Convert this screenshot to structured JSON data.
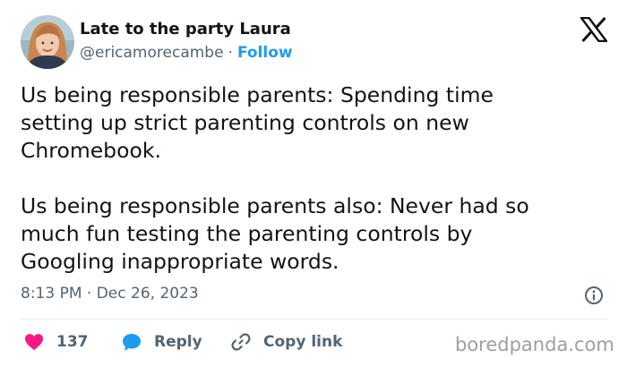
{
  "author": {
    "display_name": "Late to the party Laura",
    "handle": "@ericamorecambe",
    "separator": "·",
    "follow_label": "Follow"
  },
  "tweet": {
    "text": "Us being responsible parents: Spending time\nsetting up strict parenting controls on new\nChromebook.\n\nUs being responsible parents also: Never had so\nmuch fun testing the parenting controls by\nGoogling inappropriate words.",
    "timestamp": "8:13 PM · Dec 26, 2023"
  },
  "actions": {
    "like_count": "137",
    "reply_label": "Reply",
    "copy_link_label": "Copy link"
  },
  "icons": {
    "platform_logo": "x-logo-icon",
    "info": "info-icon",
    "like": "heart-icon",
    "reply": "speech-bubble-icon",
    "copy_link": "link-icon"
  },
  "colors": {
    "accent": "#1d9bf0",
    "like": "#f91880",
    "text": "#0f1419",
    "secondary_text": "#536471",
    "divider": "#e6ecf0"
  },
  "watermark": {
    "text": "boredpanda.com"
  }
}
